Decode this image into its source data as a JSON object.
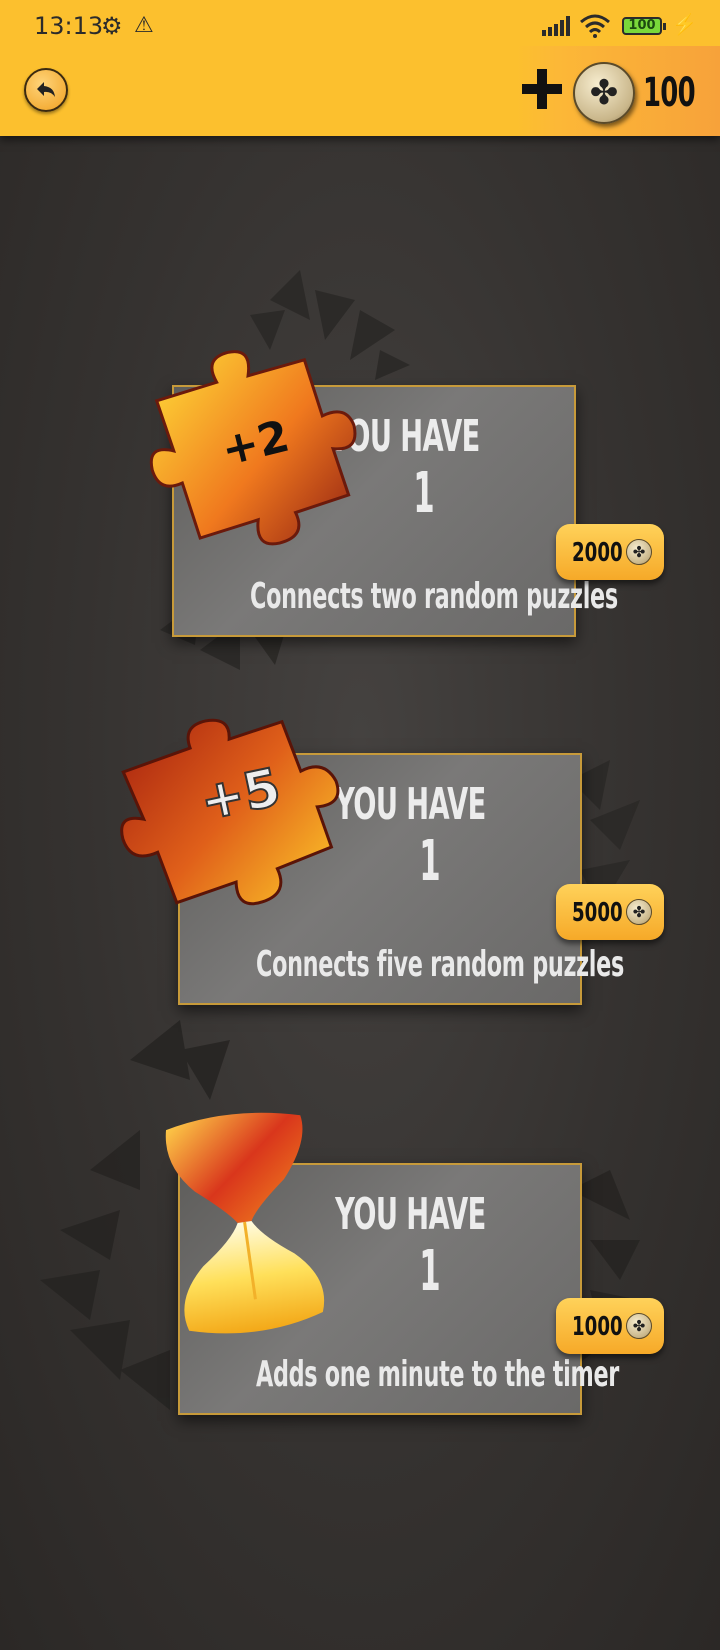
{
  "status_bar": {
    "time": "13:13",
    "battery": "100"
  },
  "header": {
    "coin_balance": "100"
  },
  "boosters": [
    {
      "badge": "+2",
      "you_have_label": "YOU HAVE",
      "count": "1",
      "description": "Connects two random puzzles",
      "price": "2000"
    },
    {
      "badge": "+5",
      "you_have_label": "YOU HAVE",
      "count": "1",
      "description": "Connects five random puzzles",
      "price": "5000"
    },
    {
      "badge": "",
      "you_have_label": "YOU HAVE",
      "count": "1",
      "description": "Adds one minute to the timer",
      "price": "1000"
    }
  ],
  "colors": {
    "header_yellow": "#fcc02e",
    "card_border": "#c79a3a",
    "price_button": "#f6a928",
    "background": "#353230"
  },
  "icons": [
    "back-arrow-icon",
    "plus-icon",
    "puzzle-coin-icon",
    "gear-icon",
    "warning-icon",
    "signal-icon",
    "wifi-icon",
    "battery-icon",
    "charging-icon",
    "puzzle-piece-icon",
    "hourglass-icon"
  ]
}
